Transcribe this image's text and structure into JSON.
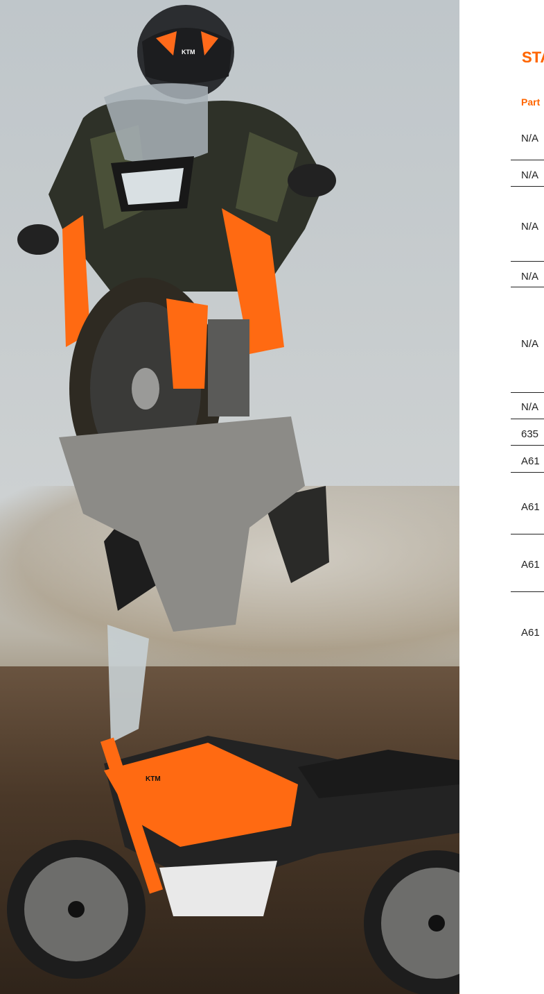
{
  "section": {
    "title": "STA"
  },
  "table": {
    "column_header": "Part",
    "rows": [
      "N/A",
      "N/A",
      "N/A",
      "N/A",
      "N/A",
      "N/A",
      "635",
      "A61",
      "A61",
      "A61",
      "A61"
    ]
  },
  "colors": {
    "accent": "#ff6600",
    "text": "#222222"
  },
  "hero": {
    "image": "motorcycle-photo",
    "helmet_logo": "KTM",
    "bike_logo": "KTM"
  }
}
